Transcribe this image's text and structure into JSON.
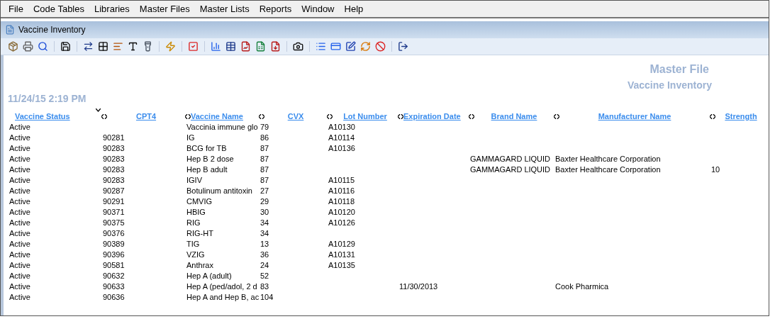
{
  "menu": [
    "File",
    "Code Tables",
    "Libraries",
    "Master Files",
    "Master Lists",
    "Reports",
    "Window",
    "Help"
  ],
  "window": {
    "title": "Vaccine Inventory"
  },
  "report": {
    "title": "Master File",
    "subtitle": "Vaccine Inventory",
    "timestamp": "11/24/15 2:19 PM"
  },
  "columns": [
    "Vaccine Status",
    "CPT4",
    "Vaccine Name",
    "CVX",
    "Lot Number",
    "Expiration Date",
    "Brand Name",
    "Manufacturer Name",
    "Strength"
  ],
  "rows": [
    [
      "Active",
      null,
      "Vaccinia immune glo",
      "79",
      "A10130",
      null,
      null,
      null,
      null
    ],
    [
      "Active",
      "90281",
      "IG",
      "86",
      "A10114",
      null,
      null,
      null,
      null
    ],
    [
      "Active",
      "90283",
      "BCG for TB",
      "87",
      "A10136",
      null,
      null,
      null,
      null
    ],
    [
      "Active",
      "90283",
      "Hep B 2 dose",
      "87",
      null,
      null,
      "GAMMAGARD LIQUID",
      "Baxter Healthcare Corporation",
      null
    ],
    [
      "Active",
      "90283",
      "Hep B adult",
      "87",
      null,
      null,
      "GAMMAGARD LIQUID",
      "Baxter Healthcare Corporation",
      "10"
    ],
    [
      "Active",
      "90283",
      "IGIV",
      "87",
      "A10115",
      null,
      null,
      null,
      null
    ],
    [
      "Active",
      "90287",
      "Botulinum antitoxin",
      "27",
      "A10116",
      null,
      null,
      null,
      null
    ],
    [
      "Active",
      "90291",
      "CMVIG",
      "29",
      "A10118",
      null,
      null,
      null,
      null
    ],
    [
      "Active",
      "90371",
      "HBIG",
      "30",
      "A10120",
      null,
      null,
      null,
      null
    ],
    [
      "Active",
      "90375",
      "RIG",
      "34",
      "A10126",
      null,
      null,
      null,
      null
    ],
    [
      "Active",
      "90376",
      "RIG-HT",
      "34",
      null,
      null,
      null,
      null,
      null
    ],
    [
      "Active",
      "90389",
      "TIG",
      "13",
      "A10129",
      null,
      null,
      null,
      null
    ],
    [
      "Active",
      "90396",
      "VZIG",
      "36",
      "A10131",
      null,
      null,
      null,
      null
    ],
    [
      "Active",
      "90581",
      "Anthrax",
      "24",
      "A10135",
      null,
      null,
      null,
      null
    ],
    [
      "Active",
      "90632",
      "Hep A (adult)",
      "52",
      null,
      null,
      null,
      null,
      null
    ],
    [
      "Active",
      "90633",
      "Hep A (ped/adol, 2 d",
      "83",
      null,
      "11/30/2013",
      null,
      "Cook Pharmica",
      null
    ],
    [
      "Active",
      "90636",
      "Hep A and Hep B, ac",
      "104",
      null,
      null,
      null,
      null,
      null
    ]
  ]
}
